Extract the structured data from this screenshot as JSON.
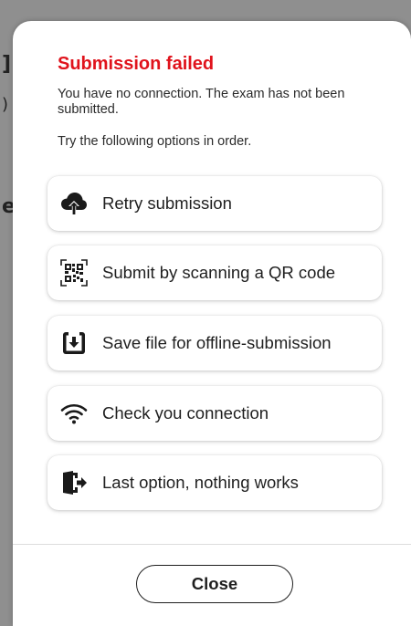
{
  "dialog": {
    "title": "Submission failed",
    "message": "You have no connection. The exam has not been submitted.",
    "hint": "Try the following options in order.",
    "title_color": "#e0131c"
  },
  "options": [
    {
      "label": "Retry submission",
      "icon": "cloud-upload-icon"
    },
    {
      "label": "Submit by scanning a QR code",
      "icon": "qr-code-icon"
    },
    {
      "label": "Save file for offline-submission",
      "icon": "download-box-icon"
    },
    {
      "label": "Check you connection",
      "icon": "wifi-icon"
    },
    {
      "label": "Last option, nothing works",
      "icon": "exit-door-icon"
    }
  ],
  "footer": {
    "close_label": "Close"
  }
}
